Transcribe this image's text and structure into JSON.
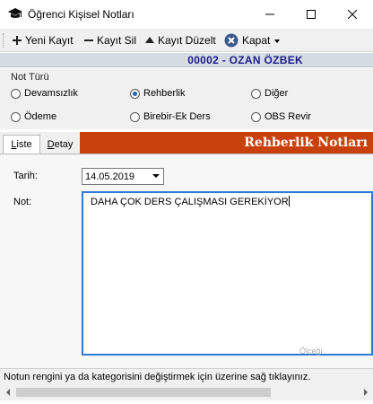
{
  "window": {
    "title": "Öğrenci Kişisel Notları",
    "icon": "graduation-cap-icon"
  },
  "toolbar": {
    "new_label": "Yeni Kayıt",
    "delete_label": "Kayıt Sil",
    "edit_label": "Kayıt Düzelt",
    "close_label": "Kapat"
  },
  "record": {
    "label": "00002 - OZAN ÖZBEK"
  },
  "note_type": {
    "title": "Not Türü",
    "options": [
      {
        "label": "Devamsızlık",
        "selected": false
      },
      {
        "label": "Rehberlik",
        "selected": true
      },
      {
        "label": "Diğer",
        "selected": false
      },
      {
        "label": "Ödeme",
        "selected": false
      },
      {
        "label": "Birebir-Ek Ders",
        "selected": false
      },
      {
        "label": "OBS Revir",
        "selected": false
      }
    ]
  },
  "tabs": {
    "liste_first": "L",
    "liste_rest": "iste",
    "detay_first": "D",
    "detay_rest": "etay"
  },
  "notes_header": "Rehberlik Notları",
  "form": {
    "date_label": "Tarih:",
    "date_value": "14.05.2019",
    "note_label": "Not:",
    "note_value": "DAHA ÇOK DERS ÇALIŞMASI GEREKİYOR",
    "hint": "Ölçeği"
  },
  "status": {
    "text": "Notun rengini ya da kategorisini değiştirmek için üzerine sağ tıklayınız."
  },
  "colors": {
    "accent": "#c8400c",
    "record_text": "#1c1c8c",
    "focus_border": "#2f7ad6"
  }
}
